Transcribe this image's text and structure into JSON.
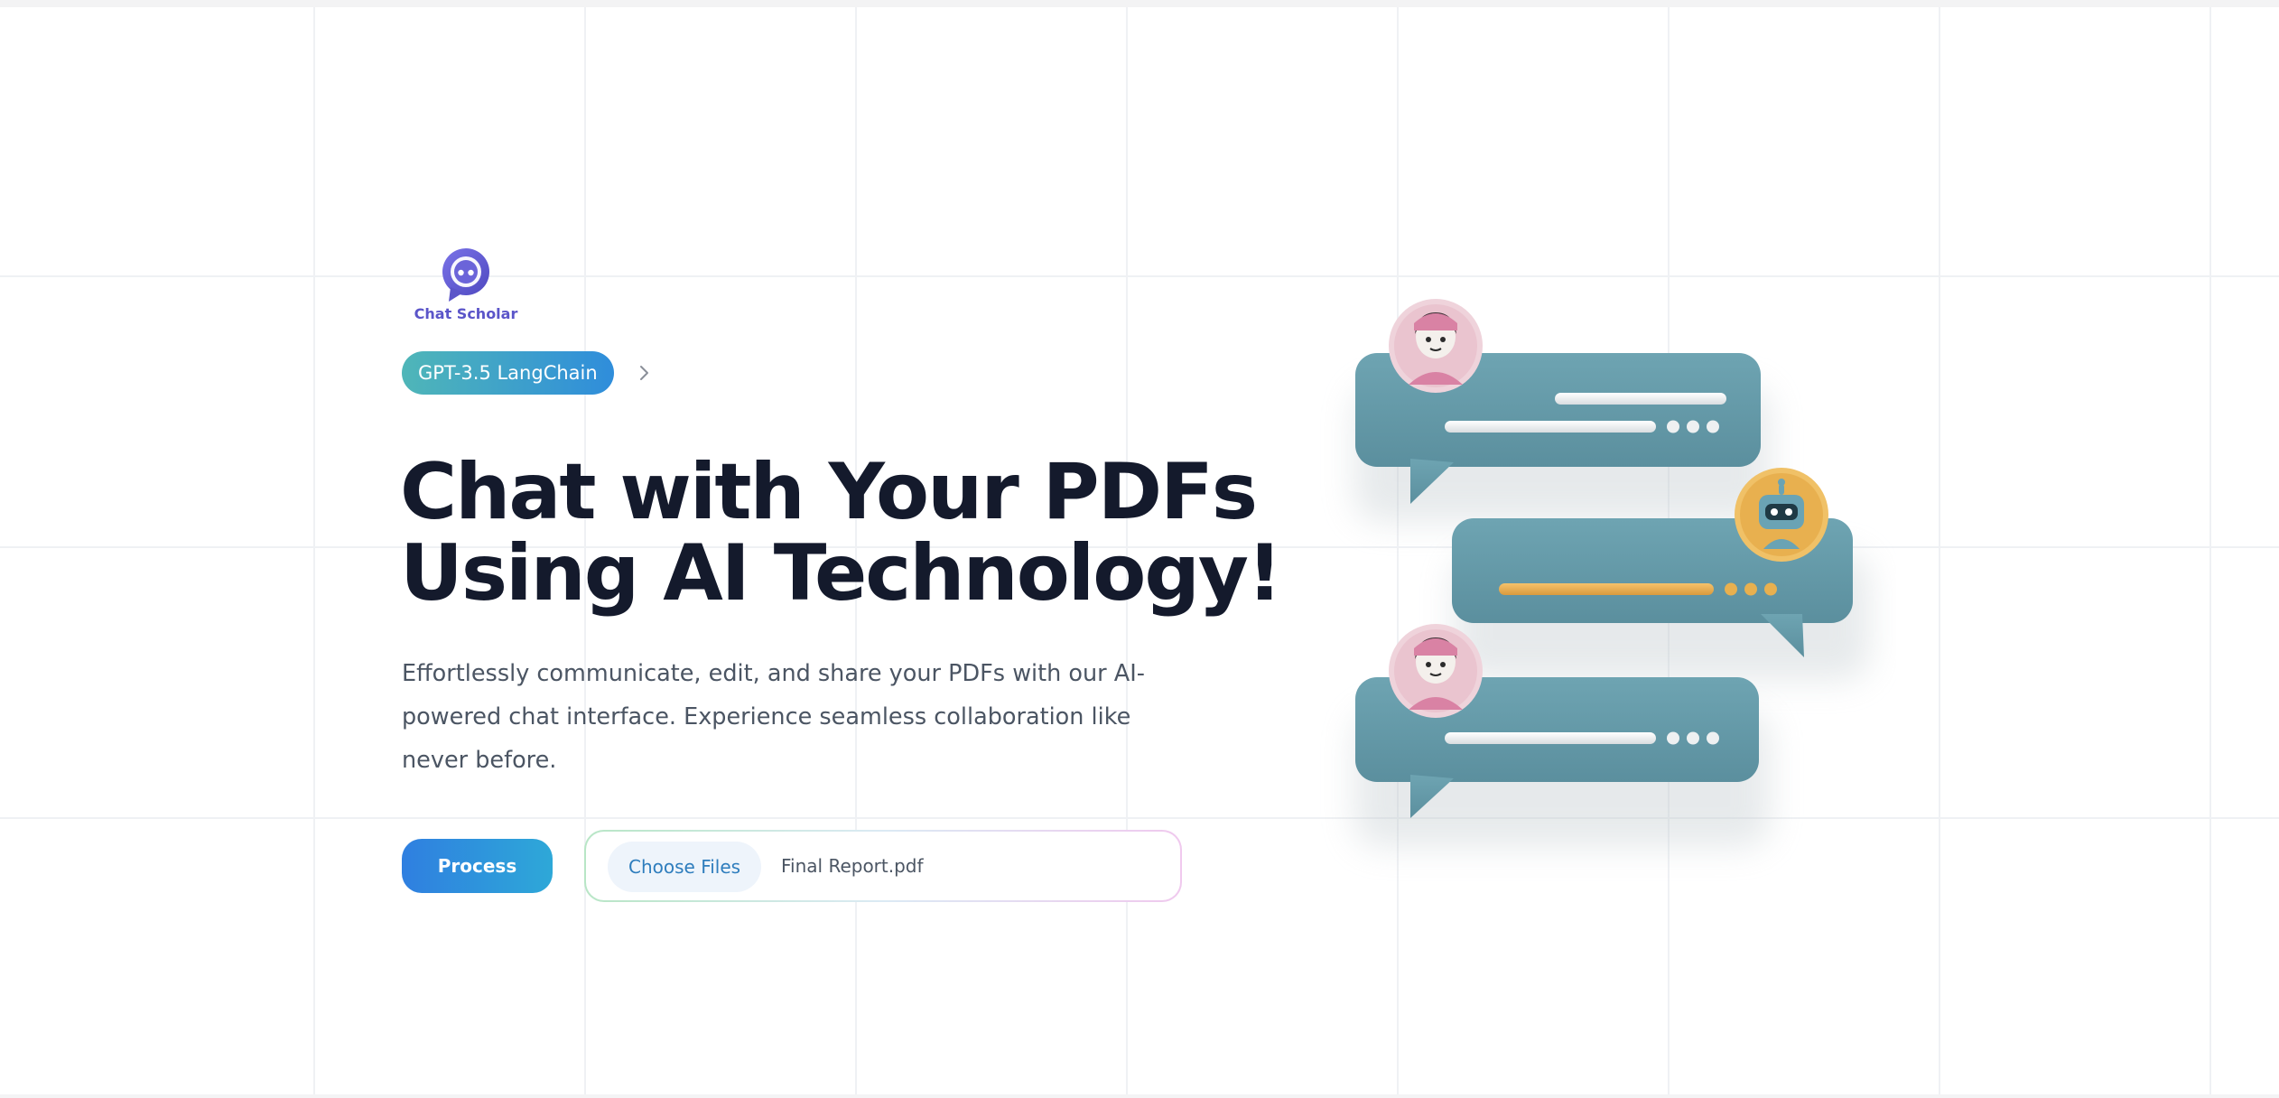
{
  "brand": {
    "name": "Chat Scholar",
    "color": "#5b55c9"
  },
  "badge": {
    "label": "GPT-3.5 LangChain"
  },
  "hero": {
    "headline_line1": "Chat with Your PDFs",
    "headline_line2": "Using AI Technology!",
    "description": "Effortlessly communicate, edit, and share your PDFs with our AI-powered chat interface. Experience seamless collaboration like never before."
  },
  "actions": {
    "process_label": "Process",
    "choose_files_label": "Choose Files",
    "selected_file": "Final Report.pdf"
  },
  "illustration": {
    "bubble_color": "#6a9fae",
    "robot_color": "#e8b04f",
    "user_avatar_color": "#eac4cf"
  }
}
